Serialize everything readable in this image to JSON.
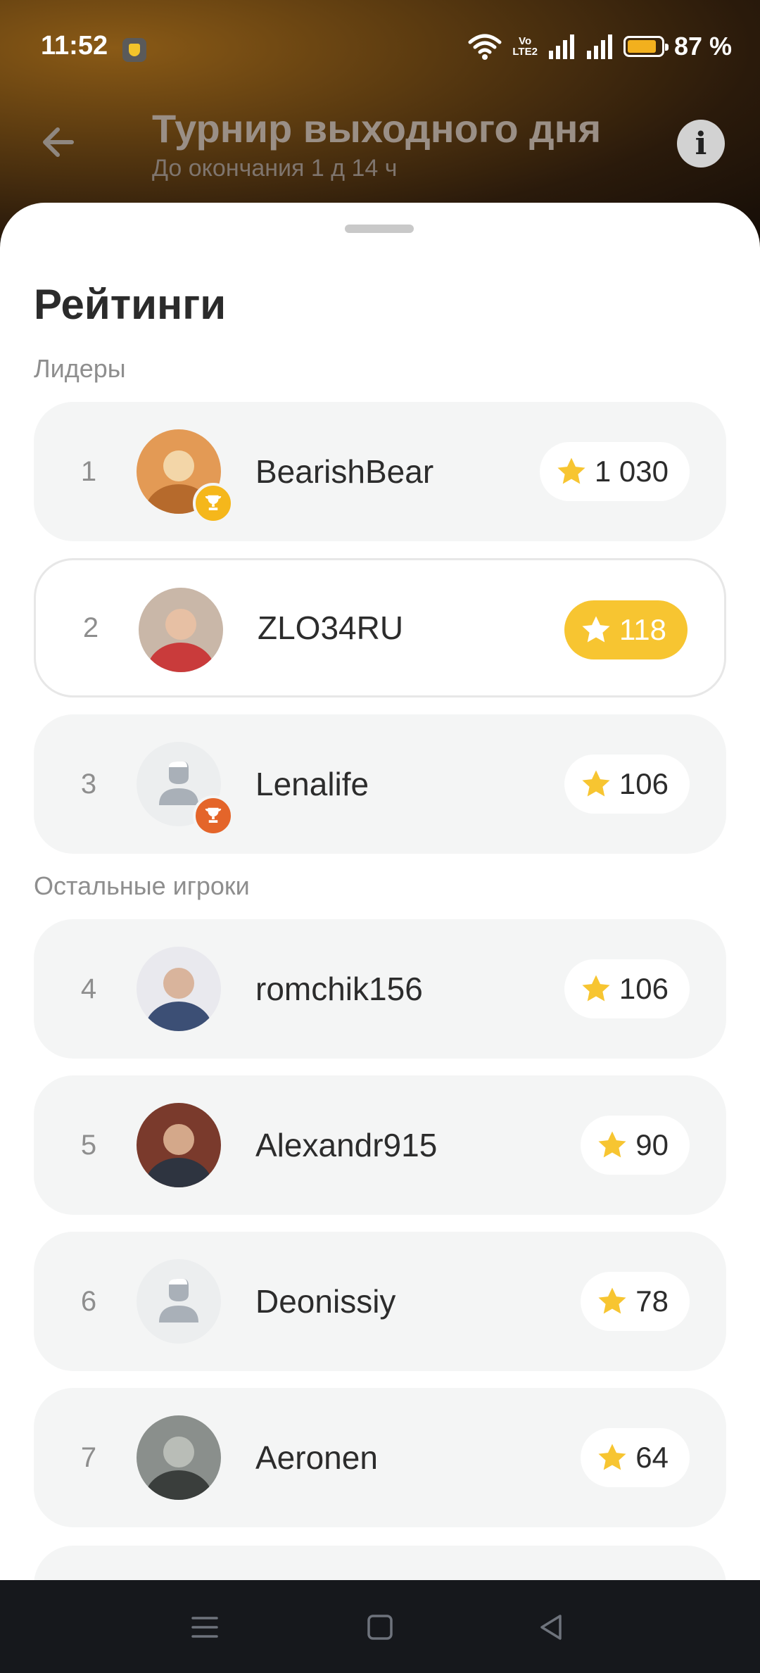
{
  "status_bar": {
    "time": "11:52",
    "network_label_top": "Vo",
    "network_label_bottom": "LTE2",
    "battery_percent": "87 %",
    "battery_level": 0.87
  },
  "header": {
    "title": "Турнир выходного дня",
    "subtitle": "До окончания 1 д 14 ч"
  },
  "sheet": {
    "title": "Рейтинги",
    "leaders_label": "Лидеры",
    "others_label": "Остальные игроки"
  },
  "colors": {
    "gold_badge": "#f7c531",
    "star": "#f7c531",
    "trophy_gold": "#f5b71b",
    "trophy_bronze": "#e4652a"
  },
  "leaders": [
    {
      "rank": "1",
      "name": "BearishBear",
      "score": "1 030",
      "avatar": "kitten-photo",
      "trophy": "gold"
    },
    {
      "rank": "2",
      "name": "ZLO34RU",
      "score": "118",
      "avatar": "person-photo-red-shirt",
      "highlight": true
    },
    {
      "rank": "3",
      "name": "Lenalife",
      "score": "106",
      "avatar": "default-user-icon",
      "trophy": "bronze"
    }
  ],
  "others": [
    {
      "rank": "4",
      "name": "romchik156",
      "score": "106",
      "avatar": "person-photo-suit"
    },
    {
      "rank": "5",
      "name": "Alexandr915",
      "score": "90",
      "avatar": "person-photo-office"
    },
    {
      "rank": "6",
      "name": "Deonissiy",
      "score": "78",
      "avatar": "default-user-icon"
    },
    {
      "rank": "7",
      "name": "Aeronen",
      "score": "64",
      "avatar": "car-photo"
    }
  ]
}
